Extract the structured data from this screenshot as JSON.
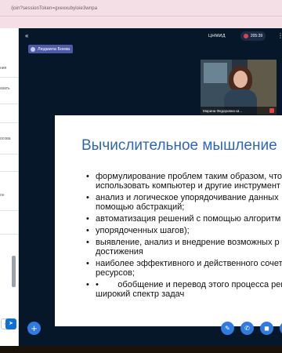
{
  "browser": {
    "url": "/join?sessionToken=gxexxubyloie3wnpa"
  },
  "sidebar": {
    "fragments": [
      "ния",
      "азать",
      "осова",
      "он"
    ],
    "send_icon": "send-icon",
    "plus_icon": "plus-icon"
  },
  "header": {
    "collapse_icon": "chevron-collapse-icon",
    "presenter_name": "Людмила Боева",
    "room_title": "ЦНМИД",
    "recording_time": "205:39",
    "more_icon": "more-vertical-icon"
  },
  "webcam": {
    "participant_name": "Марина Федоровна Ш..."
  },
  "slide": {
    "title": "Вычислительное мышление",
    "bullets": [
      "формулирование проблем таким образом, что\nиспользовать компьютер и другие инструмент",
      "анализ и логическое упорядочивание данных\nпомощью абстракций;",
      "автоматизация решений с помощью алгоритм",
      "упорядоченных шагов);",
      "выявление, анализ и внедрение возможных р\nдостижения",
      "наиболее эффективного и действенного сочет\nресурсов;",
      "•        обобщение и перевод этого процесса реш\nширокий спектр задач"
    ]
  },
  "controls": {
    "actions_icon": "plus-icon",
    "mic_icon": "microphone-off-icon",
    "audio_icon": "phone-icon",
    "camera_icon": "camera-icon",
    "screenshare_icon": "screen-share-icon"
  },
  "colors": {
    "meeting_bg": "#06172a",
    "accent": "#2f7be0",
    "presenter_chip": "#4e5aa6",
    "record": "#e0424b",
    "slide_title": "#2e66b8"
  }
}
